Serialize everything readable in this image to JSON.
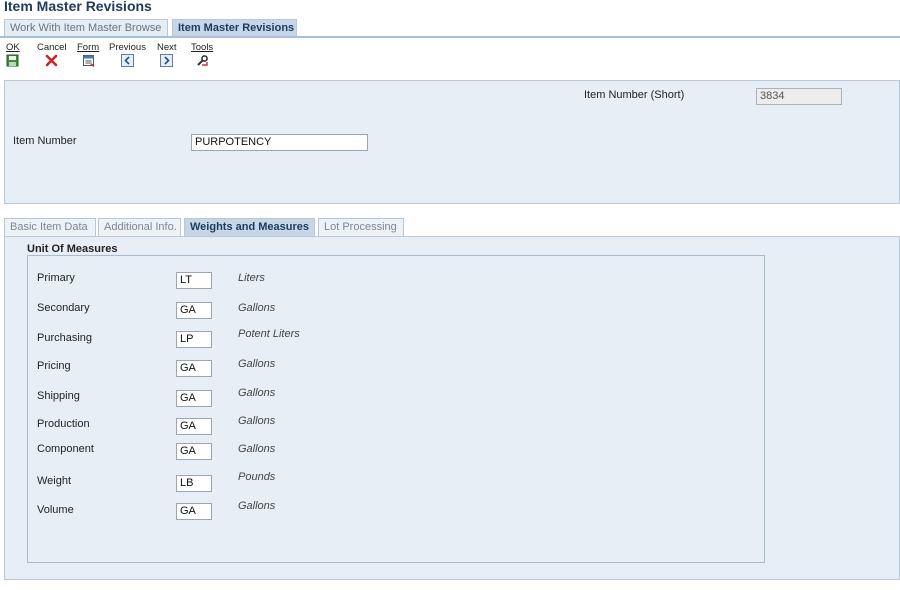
{
  "page": {
    "title": "Item Master Revisions"
  },
  "nav_tabs": [
    {
      "label": "Work With Item Master Browse",
      "active": false
    },
    {
      "label": "Item Master Revisions",
      "active": true
    }
  ],
  "toolbar": {
    "ok": {
      "label": "OK",
      "icon": "save-icon"
    },
    "cancel": {
      "label": "Cancel",
      "icon": "close-icon"
    },
    "form": {
      "label": "Form",
      "icon": "form-icon"
    },
    "previous": {
      "label": "Previous",
      "icon": "chevron-left-icon"
    },
    "next": {
      "label": "Next",
      "icon": "chevron-right-icon"
    },
    "tools": {
      "label": "Tools",
      "icon": "tools-icon"
    }
  },
  "header": {
    "item_number_short_label": "Item Number (Short)",
    "item_number_short_value": "3834",
    "item_number_label": "Item Number",
    "item_number_value": "PURPOTENCY"
  },
  "form_tabs": [
    {
      "label": "Basic Item Data",
      "active": false
    },
    {
      "label": "Additional Info.",
      "active": false
    },
    {
      "label": "Weights and Measures",
      "active": true
    },
    {
      "label": "Lot Processing",
      "active": false
    }
  ],
  "unit_of_measures": {
    "title": "Unit Of Measures",
    "rows": [
      {
        "label": "Primary",
        "code": "LT",
        "description": "Liters"
      },
      {
        "label": "Secondary",
        "code": "GA",
        "description": "Gallons"
      },
      {
        "label": "Purchasing",
        "code": "LP",
        "description": "Potent Liters"
      },
      {
        "label": "Pricing",
        "code": "GA",
        "description": "Gallons"
      },
      {
        "label": "Shipping",
        "code": "GA",
        "description": "Gallons"
      },
      {
        "label": "Production",
        "code": "GA",
        "description": "Gallons"
      },
      {
        "label": "Component",
        "code": "GA",
        "description": "Gallons"
      },
      {
        "label": "Weight",
        "code": "LB",
        "description": "Pounds"
      },
      {
        "label": "Volume",
        "code": "GA",
        "description": "Gallons"
      }
    ]
  }
}
